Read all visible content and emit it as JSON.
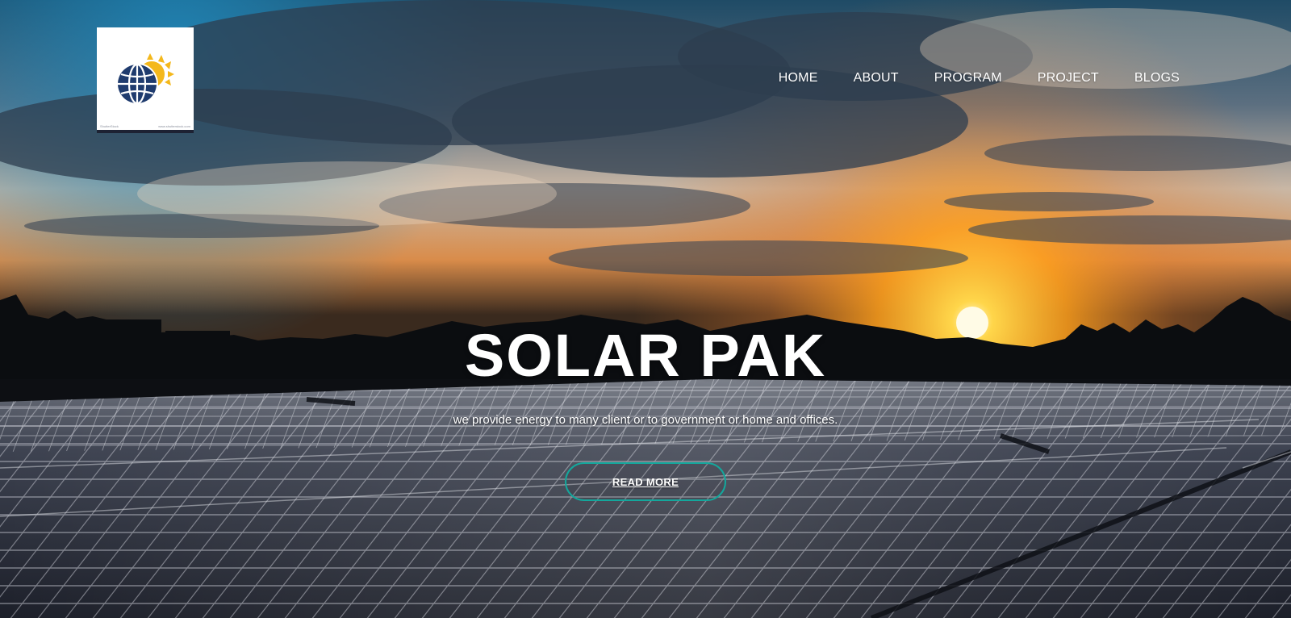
{
  "brand": {
    "logo_icon": "globe-sun-icon",
    "logo_footer_left": "ShutterStock",
    "logo_footer_right": "www.shutterstock.com"
  },
  "nav": {
    "items": [
      {
        "label": "HOME"
      },
      {
        "label": "ABOUT"
      },
      {
        "label": "PROGRAM"
      },
      {
        "label": "PROJECT"
      },
      {
        "label": "BLOGS"
      }
    ]
  },
  "hero": {
    "title": "SOLAR PAK",
    "subtitle": "we provide energy to many client or to government or home and offices.",
    "cta_label": "READ MORE",
    "cta_border_color": "#14a79c"
  }
}
